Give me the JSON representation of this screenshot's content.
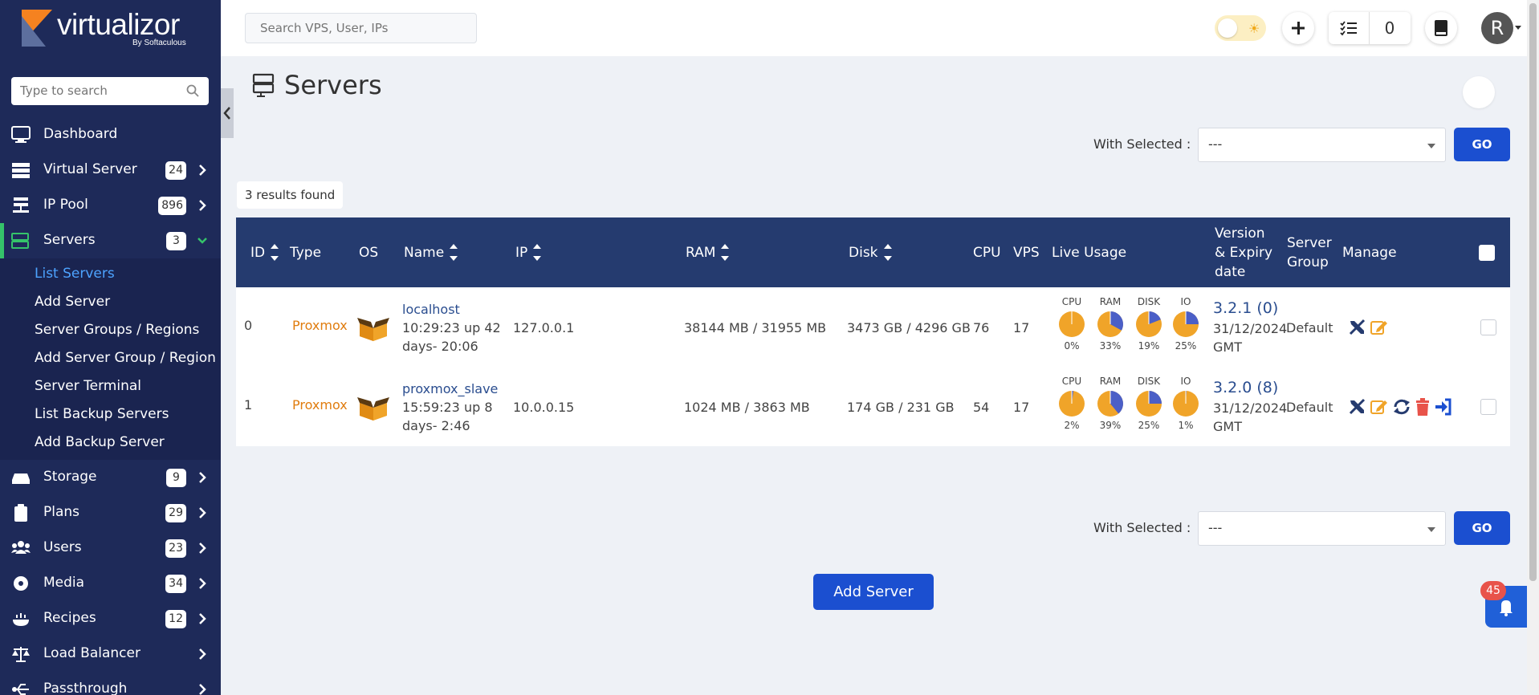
{
  "brand": {
    "name": "virtualizor",
    "sub": "By Softaculous"
  },
  "sidebar": {
    "search_placeholder": "Type to search",
    "items": [
      {
        "label": "Dashboard",
        "icon": "monitor-icon"
      },
      {
        "label": "Virtual Server",
        "badge": "24",
        "icon": "server-stack-icon"
      },
      {
        "label": "IP Pool",
        "badge": "896",
        "icon": "network-icon"
      },
      {
        "label": "Servers",
        "badge": "3",
        "icon": "servers-icon",
        "active": true
      },
      {
        "label": "Storage",
        "badge": "9",
        "icon": "storage-icon"
      },
      {
        "label": "Plans",
        "badge": "29",
        "icon": "clipboard-icon"
      },
      {
        "label": "Users",
        "badge": "23",
        "icon": "users-icon"
      },
      {
        "label": "Media",
        "badge": "34",
        "icon": "disc-icon"
      },
      {
        "label": "Recipes",
        "badge": "12",
        "icon": "recipe-icon"
      },
      {
        "label": "Load Balancer",
        "icon": "balance-icon"
      },
      {
        "label": "Passthrough",
        "icon": "passthrough-icon"
      }
    ],
    "servers_submenu": [
      "List Servers",
      "Add Server",
      "Server Groups / Regions",
      "Add Server Group / Region",
      "Server Terminal",
      "List Backup Servers",
      "Add Backup Server"
    ]
  },
  "topbar": {
    "search_placeholder": "Search VPS, User, IPs",
    "task_count": "0",
    "avatar_letter": "R"
  },
  "page": {
    "title": "Servers",
    "with_selected_label": "With Selected :",
    "with_selected_value": "---",
    "go_label": "GO",
    "results_text": "3 results found",
    "add_server_label": "Add Server",
    "notification_count": "45"
  },
  "table": {
    "headers": {
      "id": "ID",
      "type": "Type",
      "os": "OS",
      "name": "Name",
      "ip": "IP",
      "ram": "RAM",
      "disk": "Disk",
      "cpu": "CPU",
      "vps": "VPS",
      "live_usage": "Live Usage",
      "version_1": "Version",
      "version_2": "& Expiry",
      "version_3": "date",
      "group_1": "Server",
      "group_2": "Group",
      "manage": "Manage"
    },
    "usage_labels": [
      "CPU",
      "RAM",
      "DISK",
      "IO"
    ],
    "rows": [
      {
        "id": "0",
        "type": "Proxmox",
        "name": "localhost",
        "uptime_1": "10:29:23 up 42",
        "uptime_2": "days- 20:06",
        "ip": "127.0.0.1",
        "ram": "38144 MB / 31955 MB",
        "disk": "3473 GB / 4296 GB",
        "cpu": "76",
        "vps": "17",
        "usage": [
          {
            "pct": 0,
            "label": "0%"
          },
          {
            "pct": 33,
            "label": "33%"
          },
          {
            "pct": 19,
            "label": "19%"
          },
          {
            "pct": 25,
            "label": "25%"
          }
        ],
        "version": "3.2.1 (0)",
        "expiry_1": "31/12/2024",
        "expiry_2": "GMT",
        "group": "Default",
        "actions": [
          "wrench-icon",
          "edit-icon"
        ]
      },
      {
        "id": "1",
        "type": "Proxmox",
        "name": "proxmox_slave",
        "uptime_1": "15:59:23 up 8",
        "uptime_2": "days- 2:46",
        "ip": "10.0.0.15",
        "ram": "1024 MB / 3863 MB",
        "disk": "174 GB / 231 GB",
        "cpu": "54",
        "vps": "17",
        "usage": [
          {
            "pct": 2,
            "label": "2%"
          },
          {
            "pct": 39,
            "label": "39%"
          },
          {
            "pct": 25,
            "label": "25%"
          },
          {
            "pct": 1,
            "label": "1%"
          }
        ],
        "version": "3.2.0 (8)",
        "expiry_1": "31/12/2024",
        "expiry_2": "GMT",
        "group": "Default",
        "actions": [
          "wrench-icon",
          "edit-icon",
          "refresh-icon",
          "trash-icon",
          "login-icon"
        ]
      }
    ]
  },
  "colors": {
    "sidebar_bg": "#1e2a59",
    "table_head": "#253b6f",
    "primary": "#1b4fd0",
    "type_orange": "#e07c0e",
    "pie_orange": "#f0a429",
    "pie_blue": "#4b5fc7"
  }
}
